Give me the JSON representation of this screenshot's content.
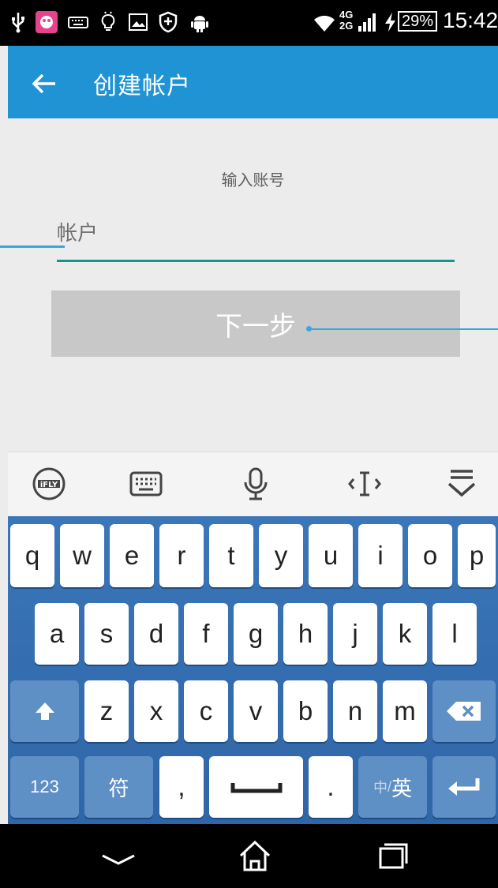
{
  "status_bar": {
    "network": "4G\n2G",
    "battery": "29%",
    "time": "15:42"
  },
  "app_bar": {
    "title": "创建帐户"
  },
  "form": {
    "prompt": "输入账号",
    "account_placeholder": "帐户",
    "account_value": "",
    "next_label": "下一步"
  },
  "keyboard": {
    "toolbar": [
      "ifly-logo-icon",
      "keyboard-icon",
      "microphone-icon",
      "cursor-icon",
      "collapse-keyboard-icon"
    ],
    "row1": [
      "q",
      "w",
      "e",
      "r",
      "t",
      "y",
      "u",
      "i",
      "o",
      "p"
    ],
    "row2": [
      "a",
      "s",
      "d",
      "f",
      "g",
      "h",
      "j",
      "k",
      "l"
    ],
    "row3": [
      "z",
      "x",
      "c",
      "v",
      "b",
      "n",
      "m"
    ],
    "bottom": {
      "num_label": "123",
      "sym_label": "符",
      "comma": ",",
      "period": ".",
      "lang_zh": "中",
      "lang_sep": "/",
      "lang_en": "英"
    },
    "colors": {
      "background": "#3a76b8",
      "key": "#ffffff",
      "fn_key": "#5e8fc5"
    }
  },
  "colors": {
    "app_bar": "#1f93d3",
    "underline": "#16958a",
    "button": "#c8c8c8"
  }
}
